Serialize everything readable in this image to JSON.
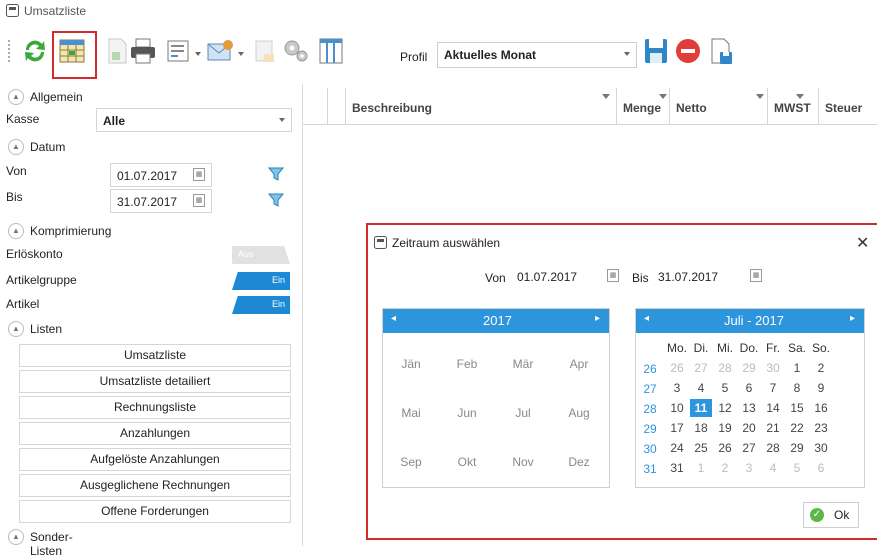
{
  "window": {
    "title": "Umsatzliste"
  },
  "toolbar": {
    "profil_label": "Profil",
    "profil_value": "Aktuelles Monat"
  },
  "left": {
    "allgemein": "Allgemein",
    "kasse_label": "Kasse",
    "kasse_value": "Alle",
    "datum": "Datum",
    "von_label": "Von",
    "von_value": "01.07.2017",
    "bis_label": "Bis",
    "bis_value": "31.07.2017",
    "komprimierung": "Komprimierung",
    "erloeskonto": "Erlöskonto",
    "erloeskonto_state": "Aus",
    "artikelgruppe": "Artikelgruppe",
    "artikelgruppe_state": "Ein",
    "artikel": "Artikel",
    "artikel_state": "Ein",
    "listen": "Listen",
    "list_buttons": [
      "Umsatzliste",
      "Umsatzliste detailiert",
      "Rechnungsliste",
      "Anzahlungen",
      "Aufgelöste Anzahlungen",
      "Ausgeglichene Rechnungen",
      "Offene Forderungen"
    ],
    "sonder": "Sonder-Listen"
  },
  "grid": {
    "columns": [
      "Beschreibung",
      "Menge",
      "Netto",
      "MWST",
      "Steuer"
    ]
  },
  "dialog": {
    "title": "Zeitraum auswählen",
    "close": "✕",
    "von_label": "Von",
    "von_value": "01.07.2017",
    "bis_label": "Bis",
    "bis_value": "31.07.2017",
    "year_title": "2017",
    "months": [
      "Jän",
      "Feb",
      "Mär",
      "Apr",
      "Mai",
      "Jun",
      "Jul",
      "Aug",
      "Sep",
      "Okt",
      "Nov",
      "Dez"
    ],
    "month_title": "Juli - 2017",
    "day_headers": [
      "Mo.",
      "Di.",
      "Mi.",
      "Do.",
      "Fr.",
      "Sa.",
      "So."
    ],
    "weeks": [
      "26",
      "27",
      "28",
      "29",
      "30",
      "31"
    ],
    "days": [
      [
        "26",
        "27",
        "28",
        "29",
        "30",
        "1",
        "2"
      ],
      [
        "3",
        "4",
        "5",
        "6",
        "7",
        "8",
        "9"
      ],
      [
        "10",
        "11",
        "12",
        "13",
        "14",
        "15",
        "16"
      ],
      [
        "17",
        "18",
        "19",
        "20",
        "21",
        "22",
        "23"
      ],
      [
        "24",
        "25",
        "26",
        "27",
        "28",
        "29",
        "30"
      ],
      [
        "31",
        "1",
        "2",
        "3",
        "4",
        "5",
        "6"
      ]
    ],
    "ok": "Ok"
  },
  "colors": {
    "accent": "#2c95dc",
    "highlight": "#d32a2a",
    "toggle_on": "#1e8ad6"
  }
}
